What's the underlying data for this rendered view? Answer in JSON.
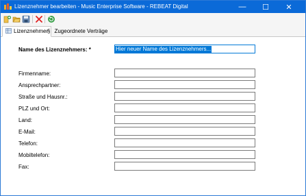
{
  "window": {
    "title": "Lizenznehmer bearbeiten - Music Enterprise Software - REBEAT Digital",
    "minimize": "—",
    "maximize": "☐",
    "close": "✕"
  },
  "toolbar": {
    "icons": [
      "new-icon",
      "open-folder-icon",
      "save-icon",
      "delete-icon",
      "refresh-icon"
    ]
  },
  "tabs": [
    {
      "label": "Lizenznehmer",
      "icon": "tab-grid-icon",
      "active": true
    },
    {
      "label": "Zugeordnete Verträge",
      "icon": "section-icon",
      "glyph": "§",
      "active": false
    }
  ],
  "form": {
    "name_label": "Name des Lizenznehmers: *",
    "name_value": "Hier neuer Name des Lizenznehmers...",
    "fields": [
      {
        "label": "Firmenname:",
        "value": ""
      },
      {
        "label": "Ansprechpartner:",
        "value": ""
      },
      {
        "label": "Straße und Hausnr.:",
        "value": ""
      },
      {
        "label": "PLZ und Ort:",
        "value": ""
      },
      {
        "label": "Land:",
        "value": ""
      },
      {
        "label": "E-Mail:",
        "value": ""
      },
      {
        "label": "Telefon:",
        "value": ""
      },
      {
        "label": "Mobiltelefon:",
        "value": ""
      },
      {
        "label": "Fax:",
        "value": ""
      }
    ]
  },
  "colors": {
    "titlebar": "#0b6ad8",
    "selection": "#0078d7",
    "delete": "#e02020"
  }
}
